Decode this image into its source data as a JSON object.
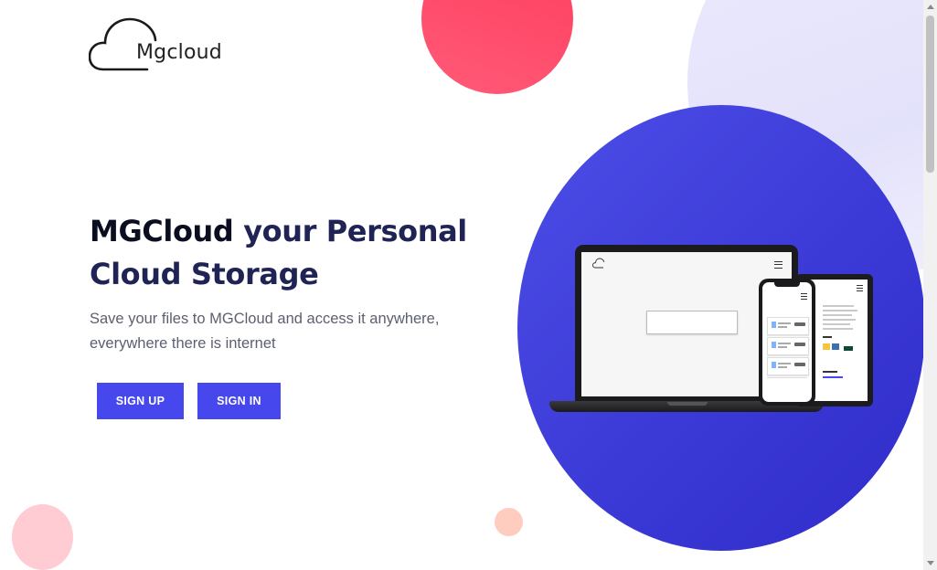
{
  "brand": {
    "logo_text": "Mgcloud"
  },
  "hero": {
    "title_dark": "MGCloud",
    "title_rest": "your Personal Cloud Storage",
    "subtitle": "Save your files to MGCloud and access it anywhere, everywhere there is internet"
  },
  "actions": {
    "signup_label": "SIGN UP",
    "signin_label": "SIGN IN"
  },
  "colors": {
    "accent": "#4648ee",
    "circle": "#3c3ad6",
    "blob_pink": "#ff4d6b",
    "title": "#1f2455"
  },
  "icons": {
    "logo": "cloud-outline-icon",
    "menu": "hamburger-menu-icon",
    "file": "document-icon"
  }
}
